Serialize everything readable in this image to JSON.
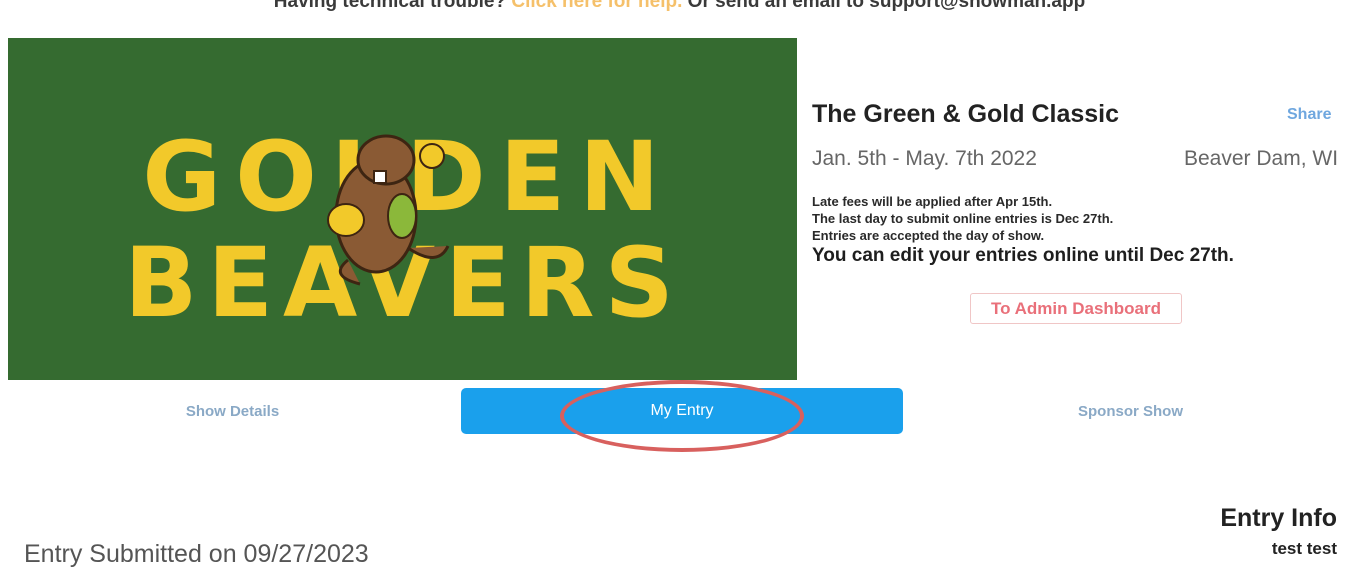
{
  "help_banner": {
    "prefix": "Having technical trouble? ",
    "link_text": "Click here for help.",
    "suffix": " Or send an email to support@showman.app"
  },
  "banner": {
    "line1": "GOLDEN",
    "line2": "BEAVERS",
    "colors": {
      "background": "#356b30",
      "text": "#f2c92a",
      "beaver": "#8a5a34"
    },
    "icon": "beaver-mascot-icon"
  },
  "show": {
    "title": "The Green & Gold Classic",
    "share_label": "Share",
    "dates": "Jan. 5th - May. 7th 2022",
    "location": "Beaver Dam, WI",
    "notes": [
      "Late fees will be applied after Apr 15th.",
      "The last day to submit online entries is Dec 27th.",
      "Entries are accepted the day of show."
    ],
    "edit_notice": "You can edit your entries online until Dec 27th.",
    "admin_button": "To Admin Dashboard"
  },
  "tabs": {
    "show_details": "Show Details",
    "my_entry": "My Entry",
    "sponsor_show": "Sponsor Show",
    "active": "my_entry"
  },
  "entry": {
    "info_title": "Entry Info",
    "name": "test test",
    "submitted": "Entry Submitted on 09/27/2023"
  },
  "colors": {
    "primary": "#1aa0ec",
    "admin": "#e9707a",
    "link": "#6fa7df",
    "highlight": "#d8605e"
  }
}
